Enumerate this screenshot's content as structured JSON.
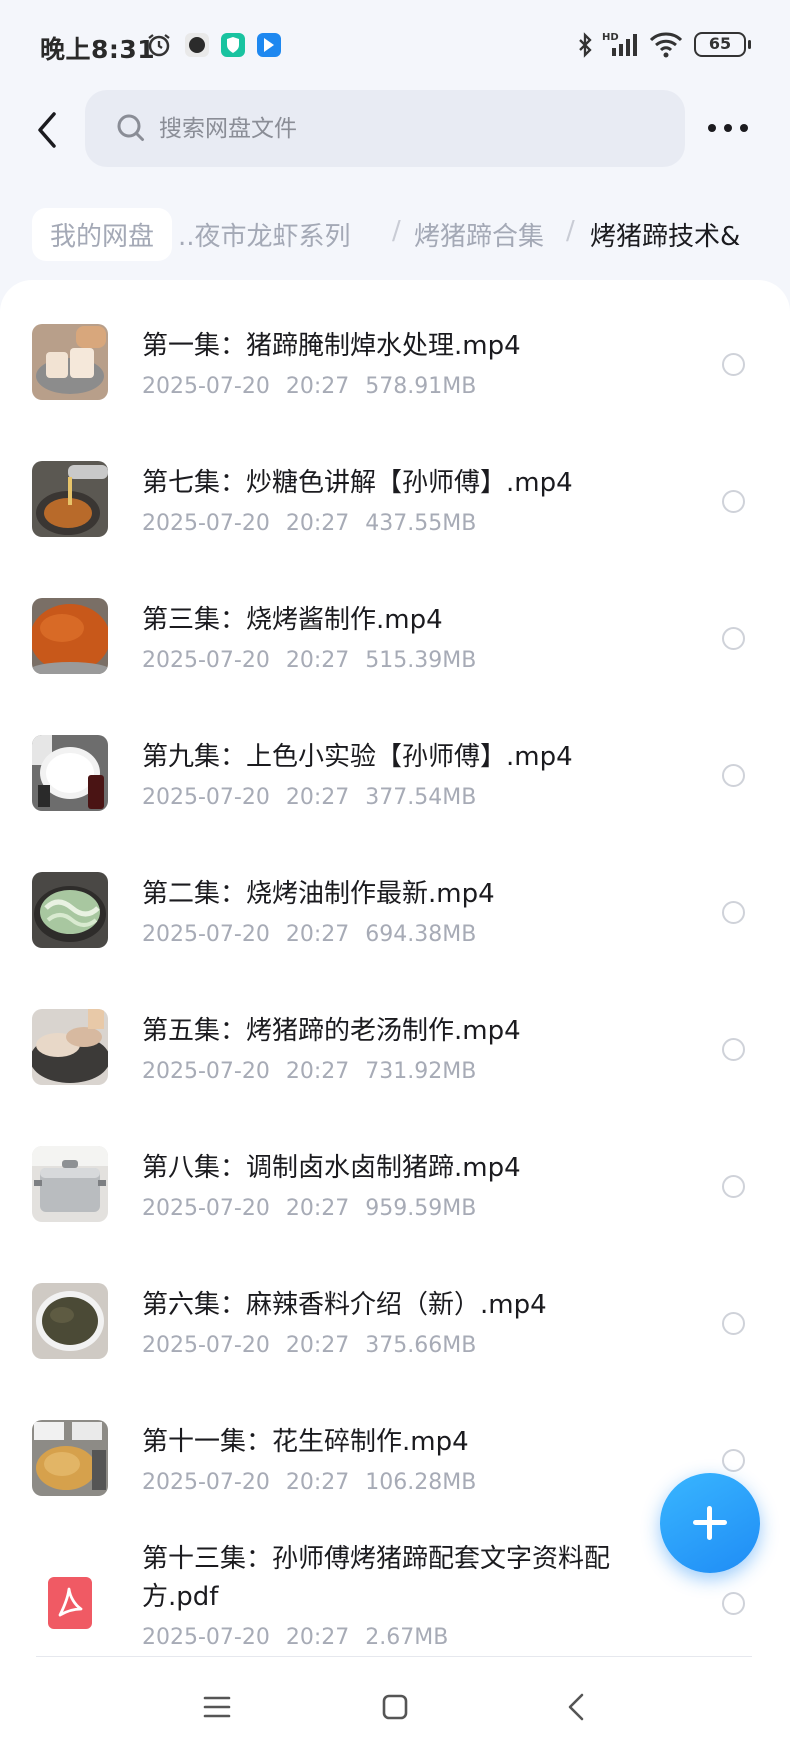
{
  "status_bar": {
    "time": "晚上8:31",
    "battery": "65",
    "icons": [
      "alarm-icon",
      "app-icon",
      "shield-app-icon",
      "messenger-app-icon",
      "bluetooth-icon",
      "hd-signal-icon",
      "wifi-icon",
      "battery-icon"
    ]
  },
  "search": {
    "placeholder": "搜索网盘文件"
  },
  "breadcrumb": {
    "home": "我的网盘",
    "items": [
      "..夜市龙虾系列",
      "烤猪蹄合集",
      "烤猪蹄技术&"
    ],
    "separator": "/"
  },
  "files": [
    {
      "name": "第一集：猪蹄腌制焯水处理.mp4",
      "date": "2025-07-20",
      "time": "20:27",
      "size": "578.91MB",
      "thumb": "video-thumbnail"
    },
    {
      "name": "第七集：炒糖色讲解【孙师傅】.mp4",
      "date": "2025-07-20",
      "time": "20:27",
      "size": "437.55MB",
      "thumb": "video-thumbnail"
    },
    {
      "name": "第三集：烧烤酱制作.mp4",
      "date": "2025-07-20",
      "time": "20:27",
      "size": "515.39MB",
      "thumb": "video-thumbnail"
    },
    {
      "name": "第九集：上色小实验【孙师傅】.mp4",
      "date": "2025-07-20",
      "time": "20:27",
      "size": "377.54MB",
      "thumb": "video-thumbnail"
    },
    {
      "name": "第二集：烧烤油制作最新.mp4",
      "date": "2025-07-20",
      "time": "20:27",
      "size": "694.38MB",
      "thumb": "video-thumbnail"
    },
    {
      "name": "第五集：烤猪蹄的老汤制作.mp4",
      "date": "2025-07-20",
      "time": "20:27",
      "size": "731.92MB",
      "thumb": "video-thumbnail"
    },
    {
      "name": "第八集：调制卤水卤制猪蹄.mp4",
      "date": "2025-07-20",
      "time": "20:27",
      "size": "959.59MB",
      "thumb": "video-thumbnail"
    },
    {
      "name": "第六集：麻辣香料介绍（新）.mp4",
      "date": "2025-07-20",
      "time": "20:27",
      "size": "375.66MB",
      "thumb": "video-thumbnail"
    },
    {
      "name": "第十一集：花生碎制作.mp4",
      "date": "2025-07-20",
      "time": "20:27",
      "size": "106.28MB",
      "thumb": "video-thumbnail"
    },
    {
      "name_line1": "第十三集：孙师傅烤猪蹄配套文字资料配",
      "name_line2": "方.pdf",
      "date": "2025-07-20",
      "time": "20:27",
      "size": "2.67MB",
      "thumb": "pdf-icon"
    }
  ],
  "colors": {
    "accent": "#1f8cf5",
    "pdf": "#f05a64",
    "muted_text": "#a7abb6",
    "background": "#f4f6fb"
  },
  "actions": {
    "fab_icon": "plus-icon",
    "more_icon": "more-dots-icon",
    "back_icon": "back-arrow-icon"
  },
  "nav_bar": {
    "icons": [
      "menu-icon",
      "home-square-icon",
      "back-triangle-icon"
    ]
  }
}
